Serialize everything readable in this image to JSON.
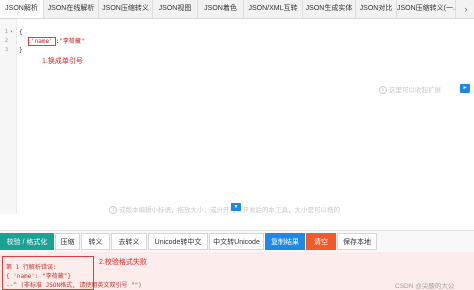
{
  "tabs": [
    {
      "label": "JSON解析"
    },
    {
      "label": "JSON在线解析"
    },
    {
      "label": "JSON压缩转义"
    },
    {
      "label": "JSON视图"
    },
    {
      "label": "JSON着色"
    },
    {
      "label": "JSON/XML互转"
    },
    {
      "label": "JSON生成实体"
    },
    {
      "label": "JSON对比"
    },
    {
      "label": "JSON压缩转义(一..."
    }
  ],
  "tab_more_icon": "chevron-right-icon",
  "editor": {
    "lines": [
      {
        "num": "1",
        "text": "{"
      },
      {
        "num": "2",
        "key": "'name'",
        "sep": ":",
        "value": "\"李荷藏\""
      },
      {
        "num": "3",
        "text": "}"
      }
    ],
    "annotation": "1.换成单引号",
    "right_hint": "这里可以收起扩展",
    "bottom_hint": "或版本编辑小标语，拖放大小，或分开可以开发后的本工具，大小是可以拖的"
  },
  "toolbar": {
    "buttons": [
      {
        "label": "校验 / 格式化",
        "style": "green"
      },
      {
        "label": "压缩",
        "style": "default"
      },
      {
        "label": "转义",
        "style": "default"
      },
      {
        "label": "去转义",
        "style": "default"
      },
      {
        "label": "Unicode转中文",
        "style": "default"
      },
      {
        "label": "中文转Unicode",
        "style": "default"
      },
      {
        "label": "复制结果",
        "style": "blue"
      },
      {
        "label": "清空",
        "style": "orange"
      },
      {
        "label": "保存本地",
        "style": "default"
      }
    ]
  },
  "error_panel": {
    "lines": [
      "第 1 行解析错误:",
      "{ 'name': \"李荷藏\"}",
      "--^ (非标准 JSON格式, 请使用英文双引号 \"\")"
    ],
    "annotation": "2.校验格式失败",
    "watermark": "CSDN @尖酸的大公"
  },
  "colors": {
    "accent_green": "#1aa394",
    "accent_blue": "#1e88e5",
    "accent_orange": "#f15a29",
    "error_red": "#e02020",
    "error_bg": "#fdecec"
  }
}
